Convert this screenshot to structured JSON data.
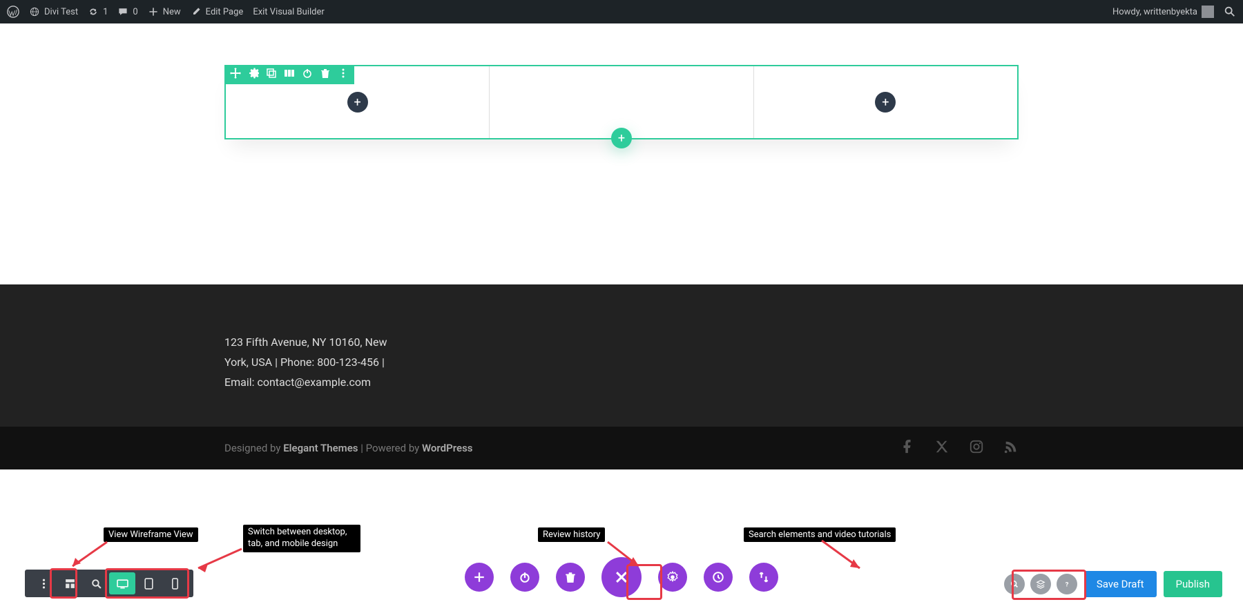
{
  "admin_bar": {
    "site_title": "Divi Test",
    "updates_count": "1",
    "comments_count": "0",
    "new_label": "New",
    "edit_page_label": "Edit Page",
    "exit_builder_label": "Exit Visual Builder",
    "howdy_text": "Howdy, writtenbyekta"
  },
  "footer": {
    "address_text": "123 Fifth Avenue, NY 10160, New York, USA | Phone: 800-123-456 | Email: contact@example.com",
    "credits_prefix": "Designed by ",
    "credits_brand": "Elegant Themes",
    "credits_mid": " | Powered by ",
    "credits_cms": "WordPress"
  },
  "annotations": {
    "wireframe": "View Wireframe View",
    "responsive": "Switch between desktop, tab, and mobile design",
    "history": "Review history",
    "search": "Search elements and video tutorials"
  },
  "buttons": {
    "save_draft": "Save Draft",
    "publish": "Publish"
  },
  "colors": {
    "accent_green": "#2ecc9b",
    "accent_purple": "#8e3cd9",
    "highlight_red": "#e63946",
    "draft_blue": "#1e88e5"
  }
}
